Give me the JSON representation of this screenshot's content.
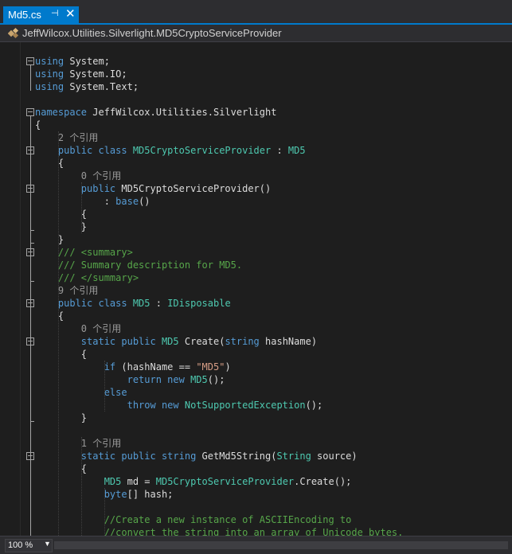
{
  "tab": {
    "title": "Md5.cs",
    "pin_icon": "pin-icon",
    "close_icon": "close-icon"
  },
  "navbar": {
    "icon": "class-icon",
    "path": "JeffWilcox.Utilities.Silverlight.MD5CryptoServiceProvider"
  },
  "code": {
    "lines": [
      [
        {
          "c": "kw",
          "t": "using"
        },
        {
          "c": "pl",
          "t": " System;"
        }
      ],
      [
        {
          "c": "kw",
          "t": "using"
        },
        {
          "c": "pl",
          "t": " System.IO;"
        }
      ],
      [
        {
          "c": "kw",
          "t": "using"
        },
        {
          "c": "pl",
          "t": " System.Text;"
        }
      ],
      [],
      [
        {
          "c": "kw",
          "t": "namespace"
        },
        {
          "c": "pl",
          "t": " JeffWilcox.Utilities.Silverlight"
        }
      ],
      [
        {
          "c": "pl",
          "t": "{"
        }
      ],
      [
        {
          "c": "rf",
          "t": "    2 个引用"
        }
      ],
      [
        {
          "c": "pl",
          "t": "    "
        },
        {
          "c": "kw",
          "t": "public class "
        },
        {
          "c": "tp",
          "t": "MD5CryptoServiceProvider"
        },
        {
          "c": "pl",
          "t": " : "
        },
        {
          "c": "tp",
          "t": "MD5"
        }
      ],
      [
        {
          "c": "pl",
          "t": "    {"
        }
      ],
      [
        {
          "c": "rf",
          "t": "        0 个引用"
        }
      ],
      [
        {
          "c": "pl",
          "t": "        "
        },
        {
          "c": "kw",
          "t": "public"
        },
        {
          "c": "pl",
          "t": " MD5CryptoServiceProvider()"
        }
      ],
      [
        {
          "c": "pl",
          "t": "            : "
        },
        {
          "c": "kw",
          "t": "base"
        },
        {
          "c": "pl",
          "t": "()"
        }
      ],
      [
        {
          "c": "pl",
          "t": "        {"
        }
      ],
      [
        {
          "c": "pl",
          "t": "        }"
        }
      ],
      [
        {
          "c": "pl",
          "t": "    }"
        }
      ],
      [
        {
          "c": "cm",
          "t": "    /// <summary>"
        }
      ],
      [
        {
          "c": "cm",
          "t": "    /// Summary description for MD5."
        }
      ],
      [
        {
          "c": "cm",
          "t": "    /// </summary>"
        }
      ],
      [
        {
          "c": "rf",
          "t": "    9 个引用"
        }
      ],
      [
        {
          "c": "pl",
          "t": "    "
        },
        {
          "c": "kw",
          "t": "public class "
        },
        {
          "c": "tp",
          "t": "MD5"
        },
        {
          "c": "pl",
          "t": " : "
        },
        {
          "c": "tp",
          "t": "IDisposable"
        }
      ],
      [
        {
          "c": "pl",
          "t": "    {"
        }
      ],
      [
        {
          "c": "rf",
          "t": "        0 个引用"
        }
      ],
      [
        {
          "c": "pl",
          "t": "        "
        },
        {
          "c": "kw",
          "t": "static public "
        },
        {
          "c": "tp",
          "t": "MD5"
        },
        {
          "c": "pl",
          "t": " Create("
        },
        {
          "c": "kw",
          "t": "string"
        },
        {
          "c": "pl",
          "t": " hashName)"
        }
      ],
      [
        {
          "c": "pl",
          "t": "        {"
        }
      ],
      [
        {
          "c": "pl",
          "t": "            "
        },
        {
          "c": "kw",
          "t": "if"
        },
        {
          "c": "pl",
          "t": " (hashName == "
        },
        {
          "c": "st",
          "t": "\"MD5\""
        },
        {
          "c": "pl",
          "t": ")"
        }
      ],
      [
        {
          "c": "pl",
          "t": "                "
        },
        {
          "c": "kw",
          "t": "return new "
        },
        {
          "c": "tp",
          "t": "MD5"
        },
        {
          "c": "pl",
          "t": "();"
        }
      ],
      [
        {
          "c": "pl",
          "t": "            "
        },
        {
          "c": "kw",
          "t": "else"
        }
      ],
      [
        {
          "c": "pl",
          "t": "                "
        },
        {
          "c": "kw",
          "t": "throw new "
        },
        {
          "c": "tp",
          "t": "NotSupportedException"
        },
        {
          "c": "pl",
          "t": "();"
        }
      ],
      [
        {
          "c": "pl",
          "t": "        }"
        }
      ],
      [],
      [
        {
          "c": "rf",
          "t": "        1 个引用"
        }
      ],
      [
        {
          "c": "pl",
          "t": "        "
        },
        {
          "c": "kw",
          "t": "static public string"
        },
        {
          "c": "pl",
          "t": " GetMd5String("
        },
        {
          "c": "tp",
          "t": "String"
        },
        {
          "c": "pl",
          "t": " source)"
        }
      ],
      [
        {
          "c": "pl",
          "t": "        {"
        }
      ],
      [
        {
          "c": "pl",
          "t": "            "
        },
        {
          "c": "tp",
          "t": "MD5"
        },
        {
          "c": "pl",
          "t": " md = "
        },
        {
          "c": "tp",
          "t": "MD5CryptoServiceProvider"
        },
        {
          "c": "pl",
          "t": ".Create();"
        }
      ],
      [
        {
          "c": "pl",
          "t": "            "
        },
        {
          "c": "kw",
          "t": "byte"
        },
        {
          "c": "pl",
          "t": "[] hash;"
        }
      ],
      [],
      [
        {
          "c": "cm",
          "t": "            //Create a new instance of ASCIIEncoding to"
        }
      ],
      [
        {
          "c": "cm",
          "t": "            //convert the string into an array of Unicode bytes."
        }
      ]
    ]
  },
  "statusbar": {
    "zoom": "100 %",
    "zoom_dropdown_icon": "chevron-down-icon"
  }
}
